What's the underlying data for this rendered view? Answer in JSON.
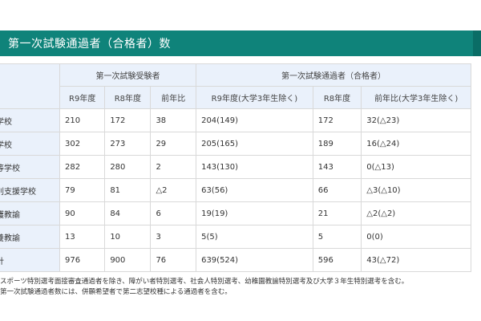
{
  "title": "第一次試験通過者（合格者）数",
  "header": {
    "group_applicants": "第一次試験受験者",
    "group_passers": "第一次試験通過者（合格者）",
    "columns": [
      "R9年度",
      "R8年度",
      "前年比",
      "R9年度(大学3年生除く)",
      "R8年度",
      "前年比(大学3年生除く)"
    ]
  },
  "rows": [
    {
      "label": "学校",
      "values": [
        "210",
        "172",
        "38",
        "204(149)",
        "172",
        "32(△23)"
      ]
    },
    {
      "label": "学校",
      "values": [
        "302",
        "273",
        "29",
        "205(165)",
        "189",
        "16(△24)"
      ]
    },
    {
      "label": "等学校",
      "values": [
        "282",
        "280",
        "2",
        "143(130)",
        "143",
        "0(△13)"
      ]
    },
    {
      "label": "別支援学校",
      "values": [
        "79",
        "81",
        "△2",
        "63(56)",
        "66",
        "△3(△10)"
      ]
    },
    {
      "label": "護教諭",
      "values": [
        "90",
        "84",
        "6",
        "19(19)",
        "21",
        "△2(△2)"
      ]
    },
    {
      "label": "養教諭",
      "values": [
        "13",
        "10",
        "3",
        "5(5)",
        "5",
        "0(0)"
      ]
    },
    {
      "label": "計",
      "values": [
        "976",
        "900",
        "76",
        "639(524)",
        "596",
        "43(△72)"
      ]
    }
  ],
  "notes": [
    "スポーツ特別選考面接審査通過者を除き、障がい者特別選考、社会人特別選考、幼稚園教諭特別選考及び大学３年生特別選考を含む。",
    "第一次試験通過者数には、併願希望者で第二志望校種による通過者を含む。"
  ]
}
